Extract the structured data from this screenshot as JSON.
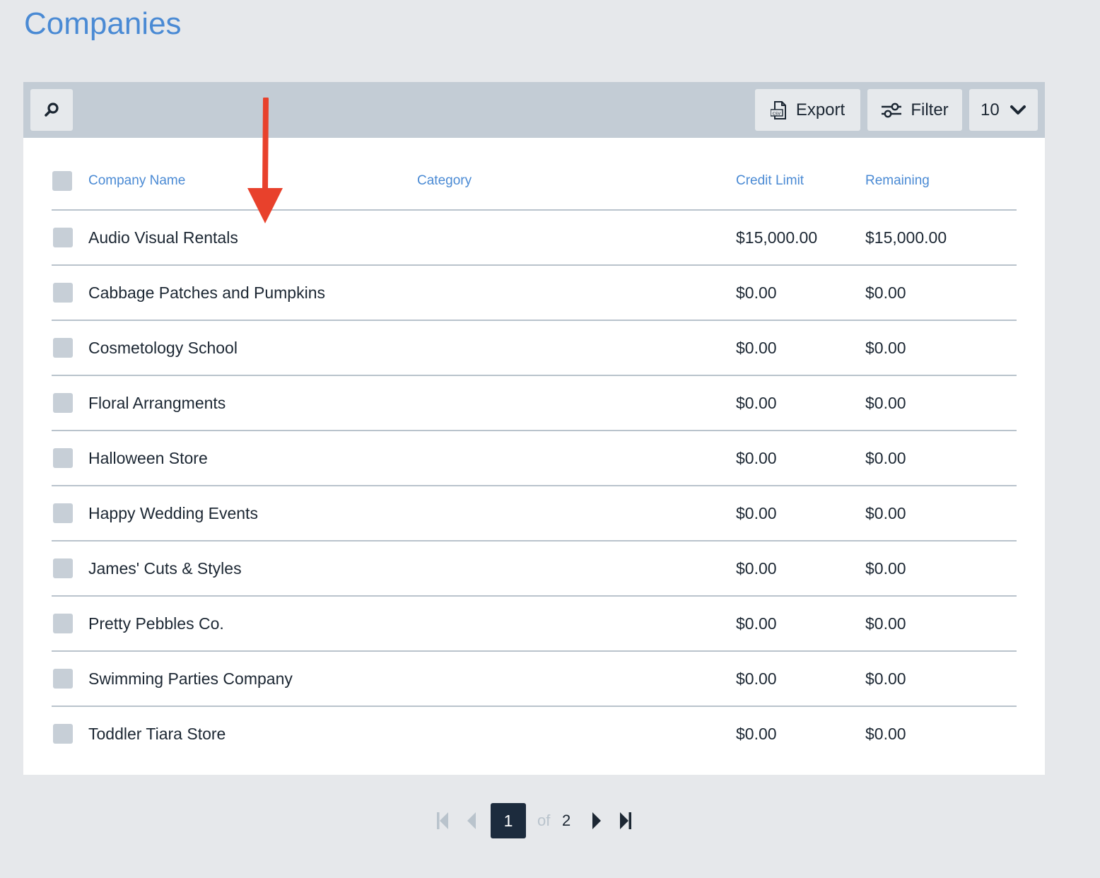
{
  "page": {
    "title": "Companies"
  },
  "toolbar": {
    "search_icon": "search-icon",
    "export_label": "Export",
    "export_icon": "csv-file-icon",
    "filter_label": "Filter",
    "filter_icon": "sliders-icon",
    "per_page_value": "10",
    "per_page_icon": "chevron-down-icon"
  },
  "table": {
    "columns": [
      "Company Name",
      "Category",
      "Credit Limit",
      "Remaining"
    ],
    "rows": [
      {
        "name": "Audio Visual Rentals",
        "category": "",
        "credit_limit": "$15,000.00",
        "remaining": "$15,000.00"
      },
      {
        "name": "Cabbage Patches and Pumpkins",
        "category": "",
        "credit_limit": "$0.00",
        "remaining": "$0.00"
      },
      {
        "name": "Cosmetology School",
        "category": "",
        "credit_limit": "$0.00",
        "remaining": "$0.00"
      },
      {
        "name": "Floral Arrangments",
        "category": "",
        "credit_limit": "$0.00",
        "remaining": "$0.00"
      },
      {
        "name": "Halloween Store",
        "category": "",
        "credit_limit": "$0.00",
        "remaining": "$0.00"
      },
      {
        "name": "Happy Wedding Events",
        "category": "",
        "credit_limit": "$0.00",
        "remaining": "$0.00"
      },
      {
        "name": "James' Cuts & Styles",
        "category": "",
        "credit_limit": "$0.00",
        "remaining": "$0.00"
      },
      {
        "name": "Pretty Pebbles Co.",
        "category": "",
        "credit_limit": "$0.00",
        "remaining": "$0.00"
      },
      {
        "name": "Swimming Parties Company",
        "category": "",
        "credit_limit": "$0.00",
        "remaining": "$0.00"
      },
      {
        "name": "Toddler Tiara Store",
        "category": "",
        "credit_limit": "$0.00",
        "remaining": "$0.00"
      }
    ]
  },
  "pagination": {
    "current_page": "1",
    "of_label": "of",
    "total_pages": "2"
  },
  "annotation": {
    "arrow_color": "#e8412c"
  },
  "colors": {
    "accent": "#4a8ad4",
    "toolbar_bg": "#c3ccd5",
    "page_bg": "#e6e8eb",
    "pager_active": "#1c2b3d"
  }
}
